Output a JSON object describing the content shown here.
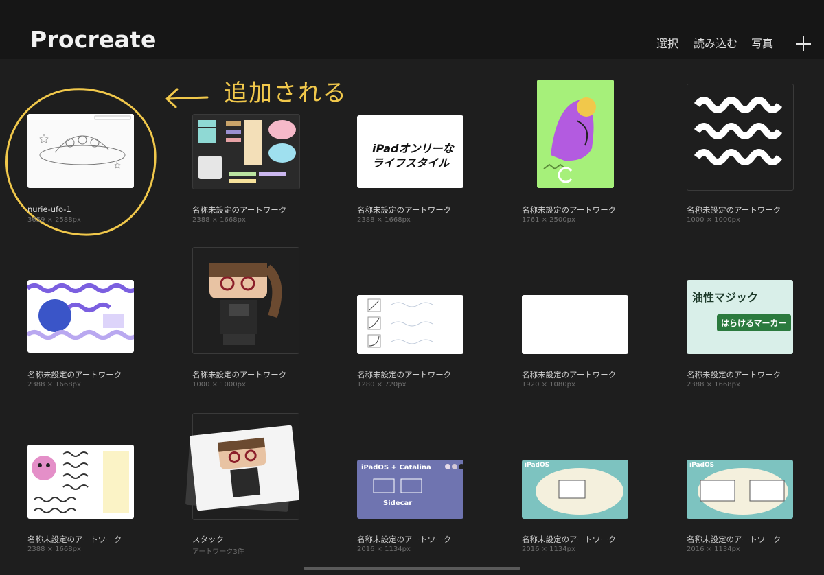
{
  "app": {
    "title": "Procreate"
  },
  "toolbar": {
    "select": "選択",
    "import": "読み込む",
    "photo": "写真",
    "add_icon": "plus-icon"
  },
  "annotation": {
    "text": "追加される"
  },
  "gallery": [
    {
      "name": "nurie-ufo-1",
      "size": "3659 × 2588px"
    },
    {
      "name": "名称未設定のアートワーク",
      "size": "2388 × 1668px"
    },
    {
      "name": "名称未設定のアートワーク",
      "size": "2388 × 1668px",
      "thumb_text_1": "iPadオンリーな",
      "thumb_text_2": "ライフスタイル"
    },
    {
      "name": "名称未設定のアートワーク",
      "size": "1761 × 2500px"
    },
    {
      "name": "名称未設定のアートワーク",
      "size": "1000 × 1000px"
    },
    {
      "name": "名称未設定のアートワーク",
      "size": "2388 × 1668px"
    },
    {
      "name": "名称未設定のアートワーク",
      "size": "1000 × 1000px"
    },
    {
      "name": "名称未設定のアートワーク",
      "size": "1280 × 720px"
    },
    {
      "name": "名称未設定のアートワーク",
      "size": "1920 × 1080px"
    },
    {
      "name": "名称未設定のアートワーク",
      "size": "2388 × 1668px",
      "thumb_text_1": "油性マジック",
      "thumb_text_2": "はらけるマーカー"
    },
    {
      "name": "名称未設定のアートワーク",
      "size": "2388 × 1668px"
    },
    {
      "name": "スタック",
      "size": "アートワーク3件"
    },
    {
      "name": "名称未設定のアートワーク",
      "size": "2016 × 1134px",
      "thumb_text_1": "iPadOS + Catalina",
      "thumb_text_2": "Sidecar"
    },
    {
      "name": "名称未設定のアートワーク",
      "size": "2016 × 1134px",
      "thumb_text_1": "iPadOS"
    },
    {
      "name": "名称未設定のアートワーク",
      "size": "2016 × 1134px",
      "thumb_text_1": "iPadOS"
    }
  ]
}
